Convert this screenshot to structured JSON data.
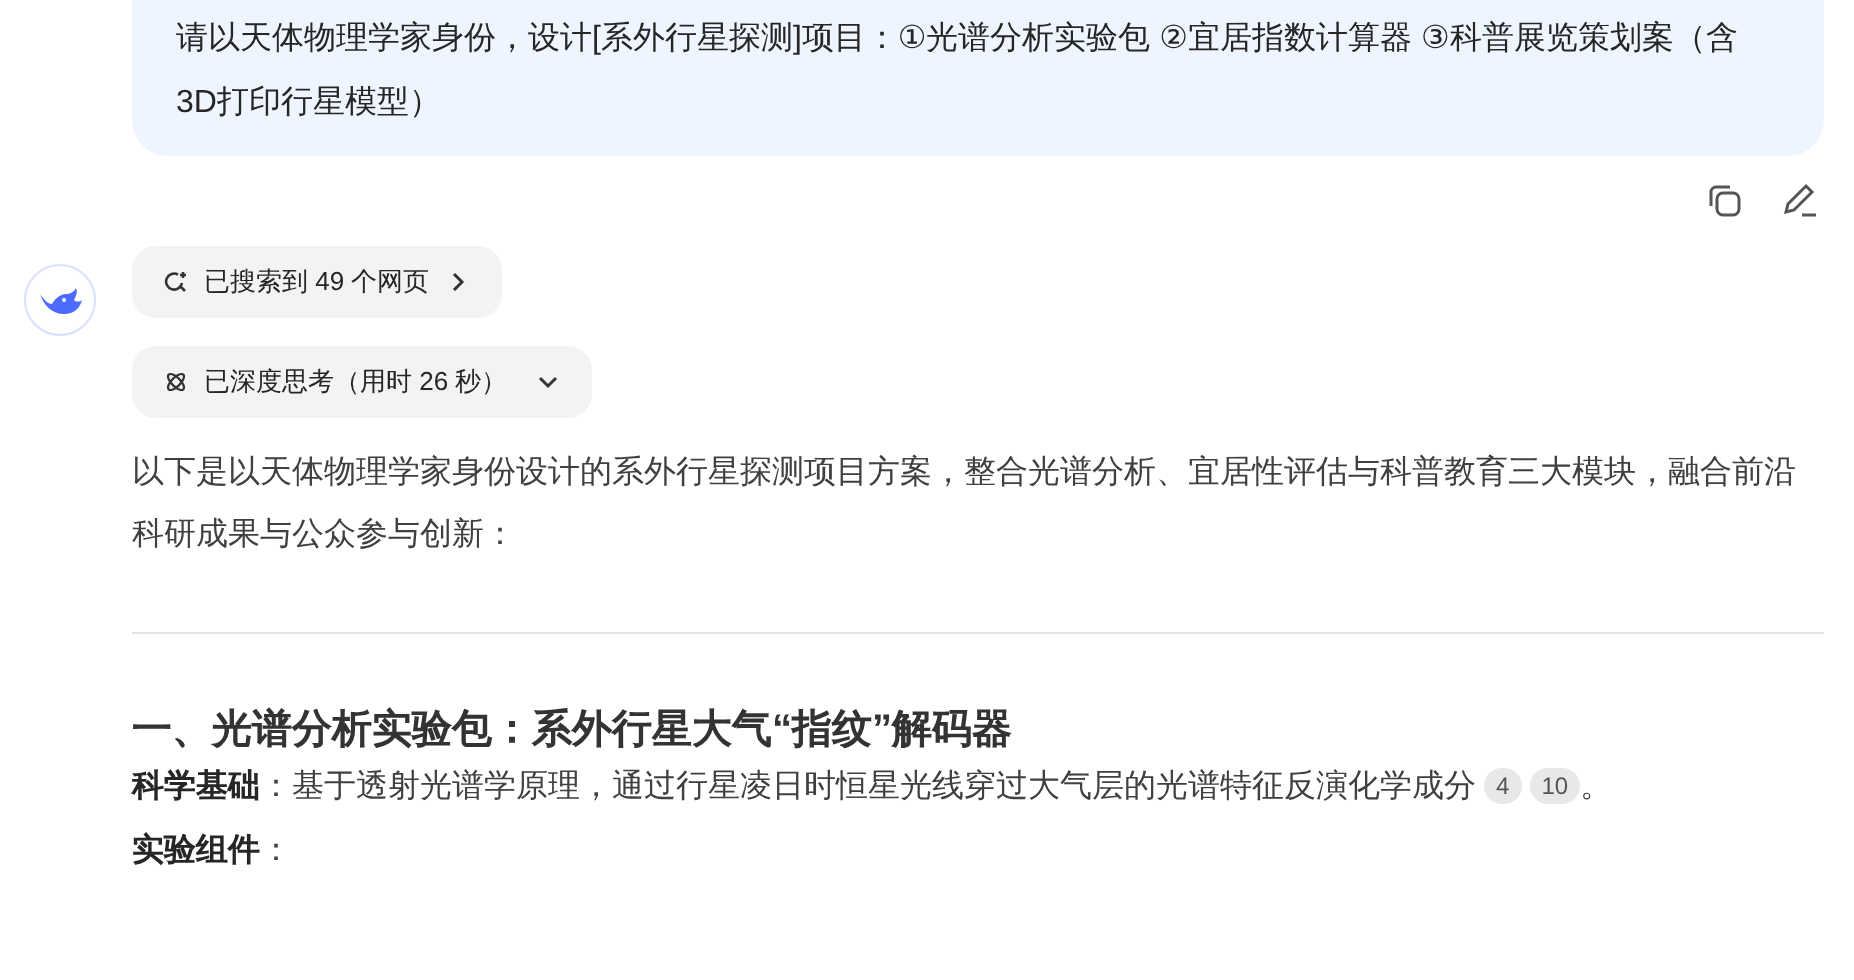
{
  "user_message": {
    "text": "请以天体物理学家身份，设计[系外行星探测]项目：①光谱分析实验包 ②宜居指数计算器 ③科普展览策划案（含3D打印行星模型）"
  },
  "assistant": {
    "chips": [
      {
        "kind": "search",
        "label": "已搜索到 49 个网页"
      },
      {
        "kind": "thinking",
        "label": "已深度思考（用时 26 秒）"
      }
    ],
    "intro": "以下是以天体物理学家身份设计的系外行星探测项目方案，整合光谱分析、宜居性评估与科普教育三大模块，融合前沿科研成果与公众参与创新：",
    "heading": "一、光谱分析实验包：系外行星大气“指纹”解码器",
    "paragraphs": [
      {
        "text": "**科学基础**：基于透射光谱学原理，通过行星凌日时恒星光线穿过大气层的光谱特征反演化学成分",
        "citations": [
          "4",
          "10"
        ],
        "end": "。"
      },
      {
        "text": "**实验组件**："
      }
    ]
  }
}
